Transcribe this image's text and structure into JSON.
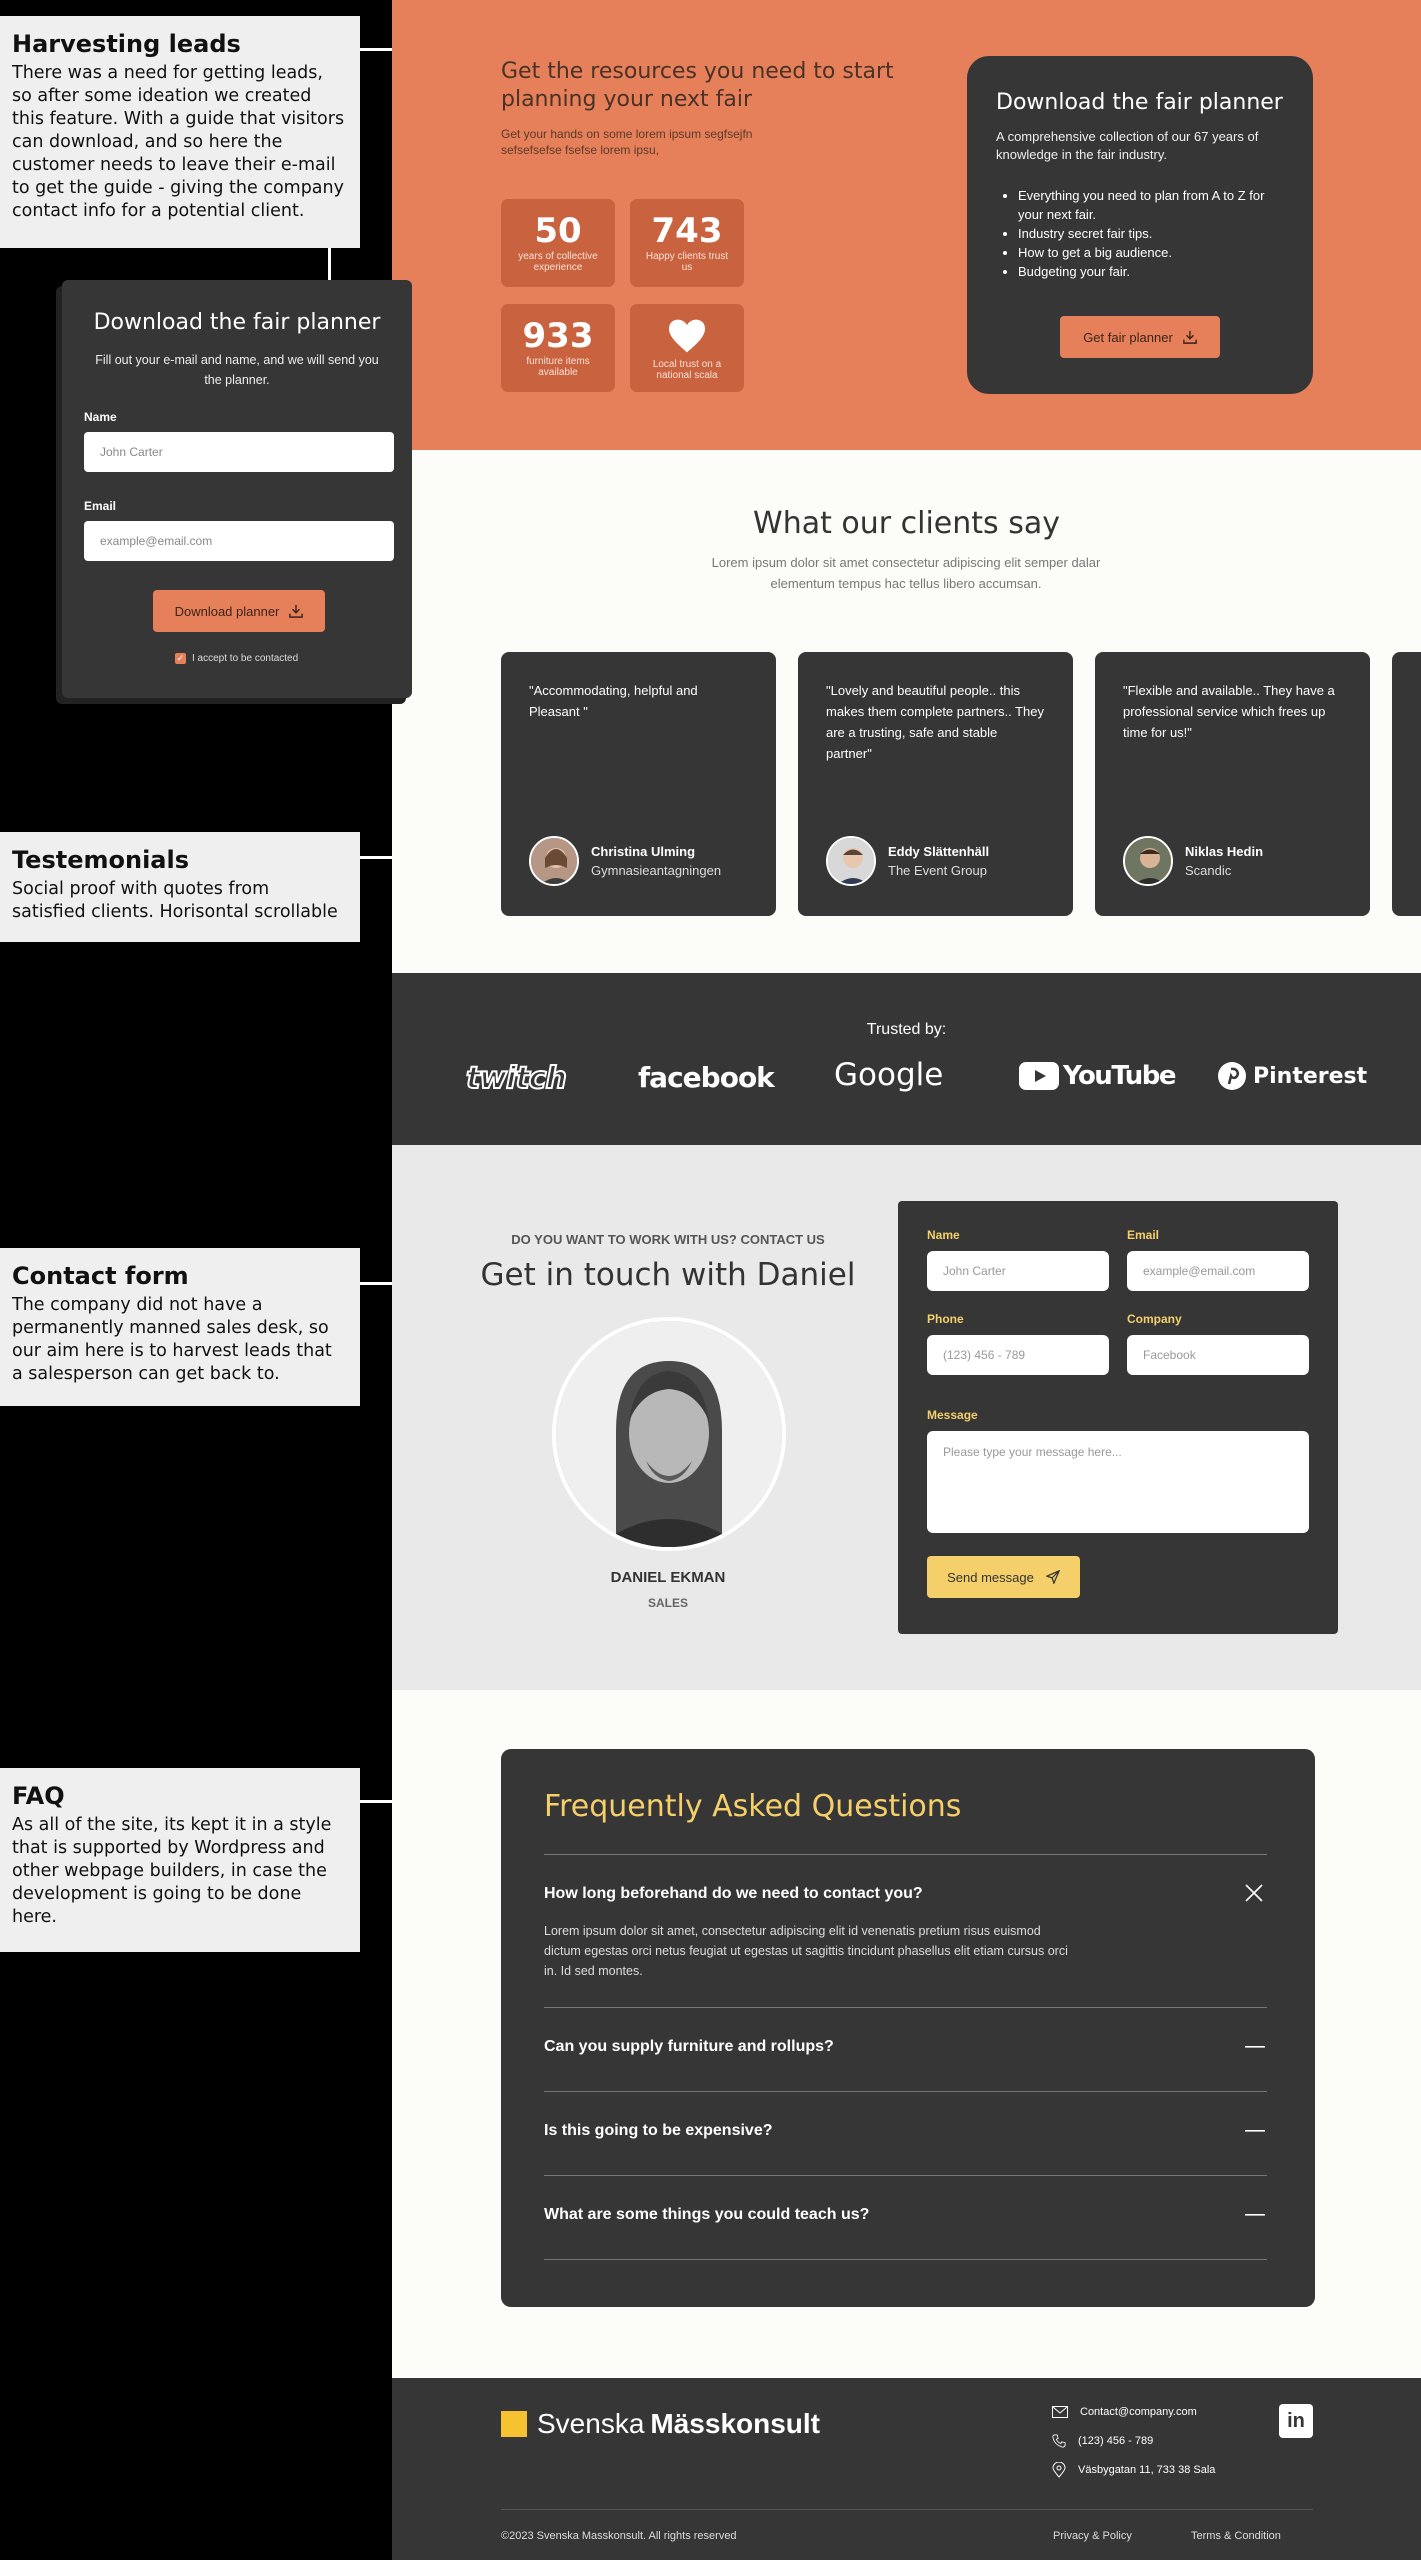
{
  "annotations": [
    {
      "title": "Harvesting leads",
      "text": "There was a need for getting leads, so after some ideation we created this feature. With a guide that visitors can download, and so here the customer needs to leave their e-mail to get the guide - giving the company contact info for a potential client."
    },
    {
      "title": "Testemonials",
      "text": "Social proof with quotes from satisfied clients. Horisontal scrollable"
    },
    {
      "title": "Contact form",
      "text": "The company did not have a permanently manned sales desk, so our aim here is to harvest leads that a salesperson can get back to."
    },
    {
      "title": "FAQ",
      "text": "As all of the site, its kept it in a style that is supported by Wordpress and other webpage builders, in case the development is going to be done here."
    }
  ],
  "lead_popup": {
    "title": "Download the fair planner",
    "description": "Fill out your e-mail and name, and we will send you the planner.",
    "name_label": "Name",
    "name_placeholder": "John Carter",
    "email_label": "Email",
    "email_placeholder": "example@email.com",
    "button_label": "Download planner",
    "consent_label": "I accept to be contacted"
  },
  "hero": {
    "title": "Get the resources you need to start planning your next fair",
    "subtitle": "Get your hands on some lorem ipsum segfsejfn sefsefsefse fsefse lorem ipsu,",
    "stats": [
      {
        "value": "50",
        "label": "years of collective experience"
      },
      {
        "value": "743",
        "label": "Happy clients trust us"
      },
      {
        "value": "933",
        "label": "furniture items available"
      },
      {
        "value": "",
        "label": "Local trust on a national scala",
        "icon": "heart-icon"
      }
    ],
    "card": {
      "title": "Download the fair planner",
      "description": "A comprehensive collection of our 67 years of knowledge in the fair industry.",
      "bullets": [
        "Everything you need to plan from A to Z for your next fair.",
        "Industry secret fair tips.",
        "How to get a big audience.",
        "Budgeting your fair."
      ],
      "button_label": "Get fair planner"
    }
  },
  "testimonials": {
    "title": "What our clients say",
    "subtitle": "Lorem ipsum dolor sit amet consectetur adipiscing elit semper dalar elementum tempus hac tellus libero accumsan.",
    "items": [
      {
        "quote": "\"Accommodating, helpful and Pleasant \"",
        "name": "Christina Ulming",
        "company": "Gymnasieantagningen"
      },
      {
        "quote": "\"Lovely and beautiful people.. this makes them complete partners.. They are a trusting, safe and stable partner\"",
        "name": "Eddy Slättenhäll",
        "company": "The Event Group"
      },
      {
        "quote": "\"Flexible and available.. They have a professional service which frees up time for us!\"",
        "name": "Niklas Hedin",
        "company": "Scandic"
      }
    ]
  },
  "trusted": {
    "title": "Trusted by:",
    "logos": [
      "twitch",
      "facebook",
      "Google",
      "YouTube",
      "Pinterest"
    ]
  },
  "contact": {
    "kicker": "DO YOU WANT TO WORK WITH US? CONTACT US",
    "title": "Get in touch with Daniel",
    "person_name": "DANIEL EKMAN",
    "person_role": "SALES",
    "form": {
      "name_label": "Name",
      "name_placeholder": "John Carter",
      "email_label": "Email",
      "email_placeholder": "example@email.com",
      "phone_label": "Phone",
      "phone_placeholder": "(123) 456 - 789",
      "company_label": "Company",
      "company_placeholder": "Facebook",
      "message_label": "Message",
      "message_placeholder": "Please type your message here...",
      "button_label": "Send message"
    }
  },
  "faq": {
    "title": "Frequently Asked Questions",
    "items": [
      {
        "question": "How long beforehand do we need to contact you?",
        "answer": "Lorem ipsum dolor sit amet, consectetur adipiscing elit id venenatis pretium risus euismod dictum egestas orci netus feugiat ut egestas ut sagittis tincidunt phasellus elit etiam cursus orci in. Id sed montes.",
        "expanded": true
      },
      {
        "question": "Can you supply furniture and rollups?",
        "expanded": false
      },
      {
        "question": "Is this going to be expensive?",
        "expanded": false
      },
      {
        "question": "What are some things you could teach us?",
        "expanded": false
      }
    ]
  },
  "footer": {
    "brand_light": "Svenska",
    "brand_bold": "Mässkonsult",
    "email": "Contact@company.com",
    "phone": "(123) 456 - 789",
    "address": "Väsbygatan 11, 733 38 Sala",
    "copyright": "©2023 Svenska Masskonsult. All rights reserved",
    "privacy": "Privacy & Policy",
    "terms": "Terms & Condition"
  },
  "colors": {
    "accent_orange": "#e6805a",
    "dark": "#363636",
    "accent_yellow": "#f5cf6a",
    "brand_square": "#f5c230"
  }
}
